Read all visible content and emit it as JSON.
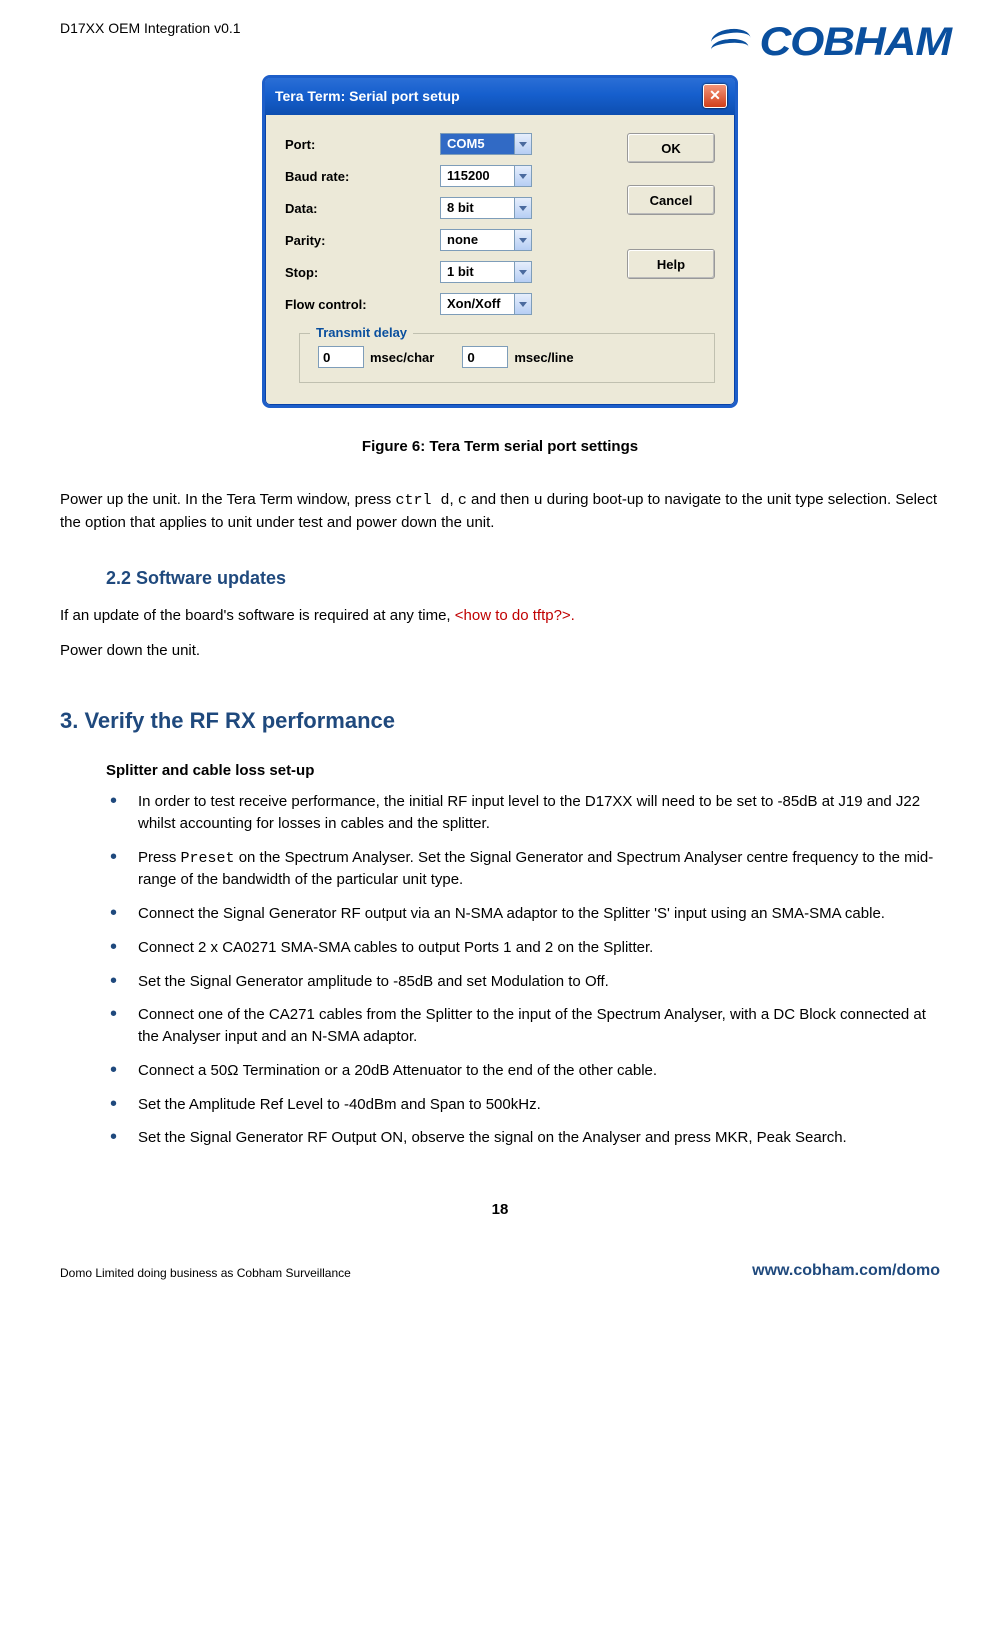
{
  "header": {
    "doc_title": "D17XX OEM Integration v0.1",
    "logo_text": "COBHAM"
  },
  "dialog": {
    "title": "Tera Term: Serial port setup",
    "fields": {
      "port": {
        "label": "Port:",
        "value": "COM5"
      },
      "baud": {
        "label": "Baud rate:",
        "value": "115200"
      },
      "data": {
        "label": "Data:",
        "value": "8 bit"
      },
      "parity": {
        "label": "Parity:",
        "value": "none"
      },
      "stop": {
        "label": "Stop:",
        "value": "1 bit"
      },
      "flow": {
        "label": "Flow control:",
        "value": "Xon/Xoff"
      }
    },
    "buttons": {
      "ok": "OK",
      "cancel": "Cancel",
      "help": "Help"
    },
    "transmit": {
      "legend": "Transmit delay",
      "char_value": "0",
      "char_label": "msec/char",
      "line_value": "0",
      "line_label": "msec/line"
    }
  },
  "figure_caption": "Figure 6: Tera Term serial port settings",
  "para1a": "Power up the unit. In the Tera Term window, press ",
  "para1_code1": "ctrl d",
  "para1b": ", ",
  "para1_code2": "c",
  "para1c": " and then ",
  "para1_code3": "u",
  "para1d": " during boot-up to navigate to the unit type selection. Select the option that applies to unit under test and power down the unit.",
  "section22": "2.2 Software updates",
  "para2a": "If an update of the board's software is required at any time, ",
  "para2_red": "<how to do tftp?>.",
  "para3": "Power down the unit.",
  "section3": "3.  Verify the RF RX performance",
  "splitter_heading": "Splitter and cable loss set-up",
  "bullets": [
    "In order to test receive performance, the initial RF input level to the D17XX will need to be set to -85dB at J19 and J22 whilst accounting for losses in cables and the splitter.",
    "__PRESET__",
    "Connect the Signal Generator RF output via an N-SMA adaptor to the Splitter 'S' input using an SMA-SMA cable.",
    "Connect 2 x CA0271 SMA-SMA cables to output Ports 1 and 2 on the Splitter.",
    "Set the Signal Generator amplitude to -85dB and set Modulation to Off.",
    "Connect one of the CA271 cables from the Splitter to the input of the Spectrum Analyser, with a DC Block connected at the Analyser input and an N-SMA adaptor.",
    "Connect a 50Ω Termination or a 20dB Attenuator to the end of the other cable.",
    "Set the Amplitude Ref Level to -40dBm and Span to 500kHz.",
    "Set the Signal Generator RF Output ON, observe the signal on the Analyser and press MKR, Peak Search."
  ],
  "bullet2_a": "Press ",
  "bullet2_code": "Preset",
  "bullet2_b": " on the Spectrum Analyser. Set the Signal Generator and Spectrum Analyser centre frequency to the mid-range of the bandwidth of the particular unit type.",
  "page_number": "18",
  "footer": {
    "left": "Domo Limited doing business as Cobham Surveillance",
    "right": "www.cobham.com/domo"
  }
}
